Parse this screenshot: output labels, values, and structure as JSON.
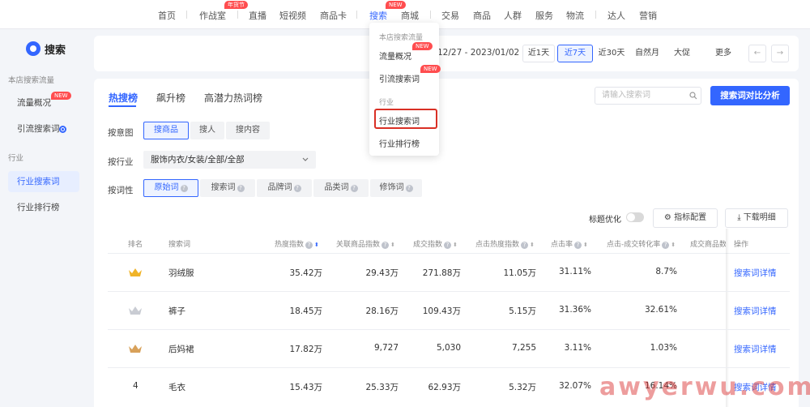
{
  "topnav": {
    "items": [
      "首页",
      "作战室",
      "直播",
      "短视频",
      "商品卡",
      "搜索",
      "商城",
      "交易",
      "商品",
      "人群",
      "服务",
      "物流",
      "达人",
      "营销"
    ],
    "badge_double": "年货节",
    "badge_new": "NEW"
  },
  "sidebar": {
    "title": "搜索",
    "group1": "本店搜索流量",
    "item_flow": "流量概况",
    "item_flow_badge": "NEW",
    "item_traffic": "引流搜索词",
    "group2": "行业",
    "item_industry_search": "行业搜索词",
    "item_industry_rank": "行业排行榜"
  },
  "datebar": {
    "range": "12/27 - 2023/01/02",
    "options": [
      "近1天",
      "近7天",
      "近30天",
      "自然月",
      "大促",
      "更多"
    ],
    "selected": "近7天",
    "prev": "←",
    "next": "→"
  },
  "dropdown": {
    "group1": "本店搜索流量",
    "item1": "流量概况",
    "item1_badge": "NEW",
    "item2": "引流搜索词",
    "item2_badge": "NEW",
    "group2": "行业",
    "item3": "行业搜索词",
    "item4": "行业排行榜"
  },
  "tabs": [
    "热搜榜",
    "飙升榜",
    "高潜力热词榜"
  ],
  "search": {
    "placeholder": "请输入搜索词",
    "compare_button": "搜索词对比分析"
  },
  "filters": {
    "intent_label": "按意图",
    "intent_options": [
      "搜商品",
      "搜人",
      "搜内容"
    ],
    "industry_label": "按行业",
    "industry_value": "服饰内衣/女装/全部/全部",
    "wordtype_label": "按词性",
    "wordtype_options": [
      "原始词",
      "搜索词",
      "品牌词",
      "品类词",
      "修饰词"
    ]
  },
  "table_tools": {
    "title_opt": "标题优化",
    "metric_config": "指标配置",
    "download": "下载明细"
  },
  "table": {
    "headers": [
      "排名",
      "搜索词",
      "热度指数",
      "关联商品指数",
      "成交指数",
      "点击热度指数",
      "点击率",
      "点击-成交转化率",
      "成交商品数",
      "操作"
    ],
    "rows": [
      {
        "rank": "",
        "word": "羽绒服",
        "heat": "35.42万",
        "goods": "29.43万",
        "deal": "271.88万",
        "click_heat": "11.05万",
        "ctr": "31.11%",
        "cvr": "8.7%",
        "action": "搜索词详情"
      },
      {
        "rank": "",
        "word": "裤子",
        "heat": "18.45万",
        "goods": "28.16万",
        "deal": "109.43万",
        "click_heat": "5.15万",
        "ctr": "31.36%",
        "cvr": "32.61%",
        "action": "搜索词详情"
      },
      {
        "rank": "",
        "word": "后妈裙",
        "heat": "17.82万",
        "goods": "9,727",
        "deal": "5,030",
        "click_heat": "7,255",
        "ctr": "3.11%",
        "cvr": "1.03%",
        "action": "搜索词详情"
      },
      {
        "rank": "4",
        "word": "毛衣",
        "heat": "15.43万",
        "goods": "25.33万",
        "deal": "62.93万",
        "click_heat": "5.32万",
        "ctr": "32.07%",
        "cvr": "16.14%",
        "action": "搜索词详情"
      }
    ]
  },
  "watermark": "awyerwu.com",
  "colors": {
    "accent": "#3366ff",
    "gold": "#f0b429",
    "silver": "#c9ccd3",
    "bronze": "#d8a15a",
    "highlight": "#d93025"
  }
}
